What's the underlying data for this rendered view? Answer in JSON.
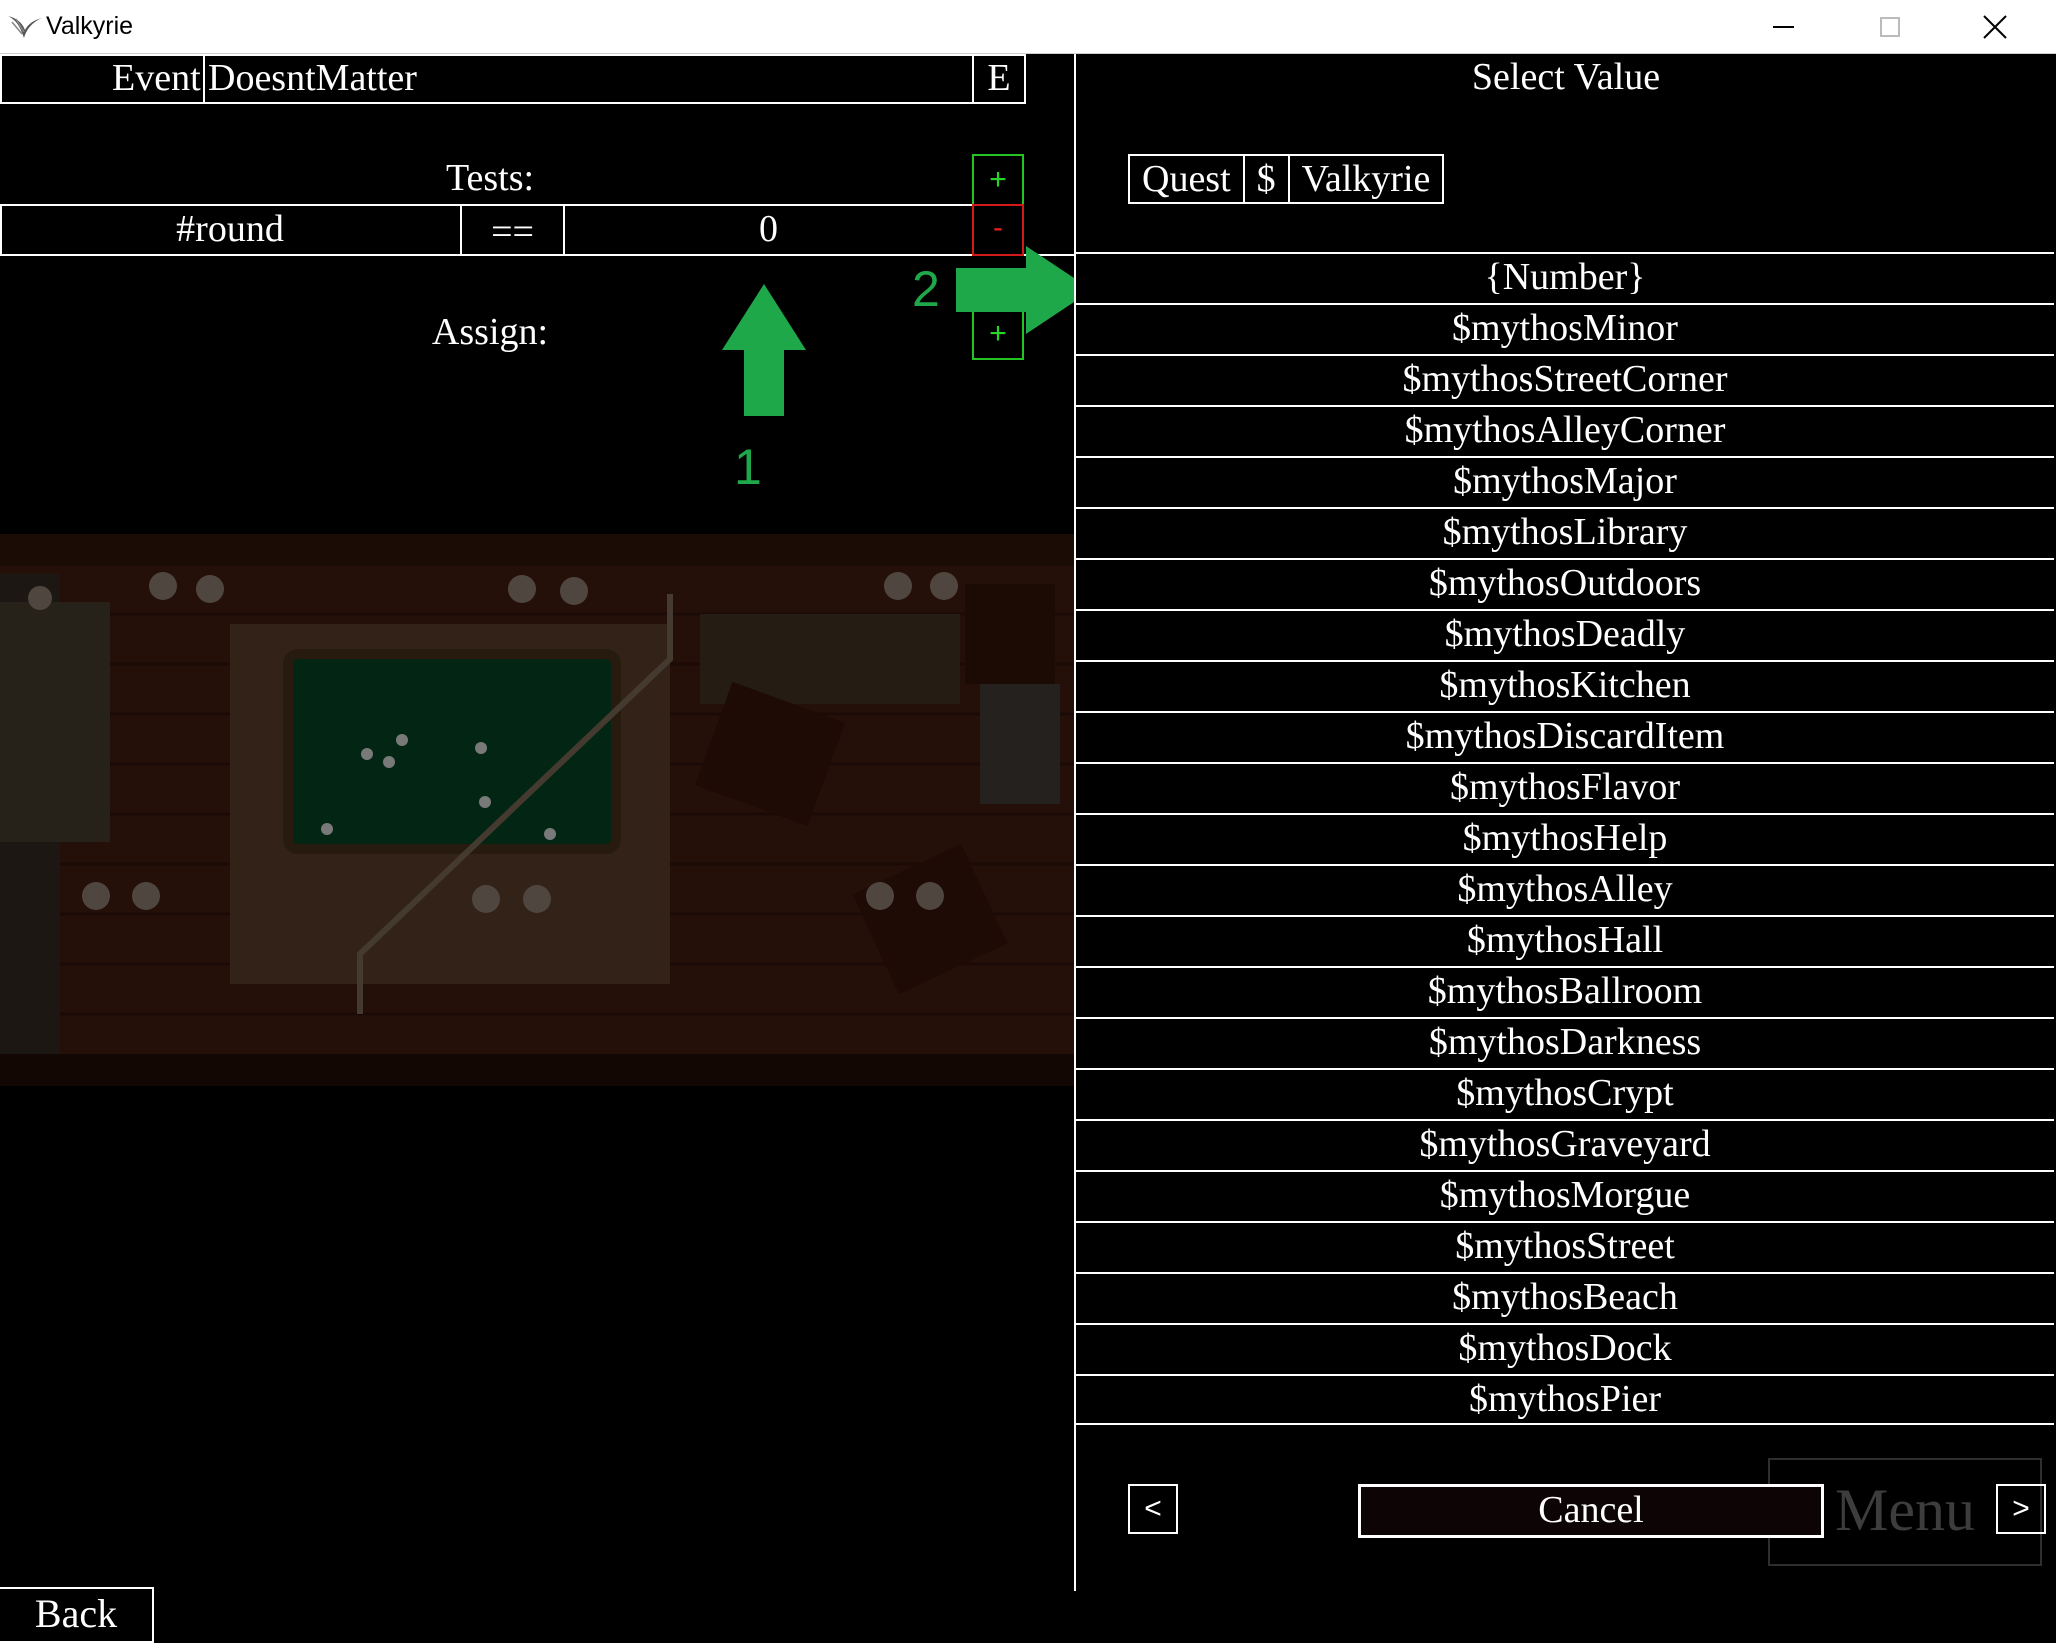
{
  "window": {
    "title": "Valkyrie",
    "app_icon": "valkyrie-wings-icon",
    "controls": {
      "minimize": "minimize-icon",
      "maximize": "maximize-icon",
      "close": "close-icon"
    }
  },
  "editor": {
    "event_label": "Event",
    "event_name": "DoesntMatter",
    "edit_button": "E",
    "tests_label": "Tests:",
    "tests_add": "+",
    "test_row": {
      "variable": "#round",
      "operator": "==",
      "value": "0",
      "remove": "-"
    },
    "assign_label": "Assign:",
    "assign_add": "+",
    "back_button": "Back"
  },
  "annotations": {
    "arrow1_label": "1",
    "arrow2_label": "2",
    "color": "#1fa84a"
  },
  "select_panel": {
    "title": "Select Value",
    "tabs": [
      "Quest",
      "$",
      "Valkyrie"
    ],
    "items": [
      "{Number}",
      "$mythosMinor",
      "$mythosStreetCorner",
      "$mythosAlleyCorner",
      "$mythosMajor",
      "$mythosLibrary",
      "$mythosOutdoors",
      "$mythosDeadly",
      "$mythosKitchen",
      "$mythosDiscardItem",
      "$mythosFlavor",
      "$mythosHelp",
      "$mythosAlley",
      "$mythosHall",
      "$mythosBallroom",
      "$mythosDarkness",
      "$mythosCrypt",
      "$mythosGraveyard",
      "$mythosMorgue",
      "$mythosStreet",
      "$mythosBeach",
      "$mythosDock",
      "$mythosPier"
    ],
    "prev_button": "<",
    "next_button": ">",
    "cancel_button": "Cancel",
    "background_menu_label": "Menu"
  }
}
